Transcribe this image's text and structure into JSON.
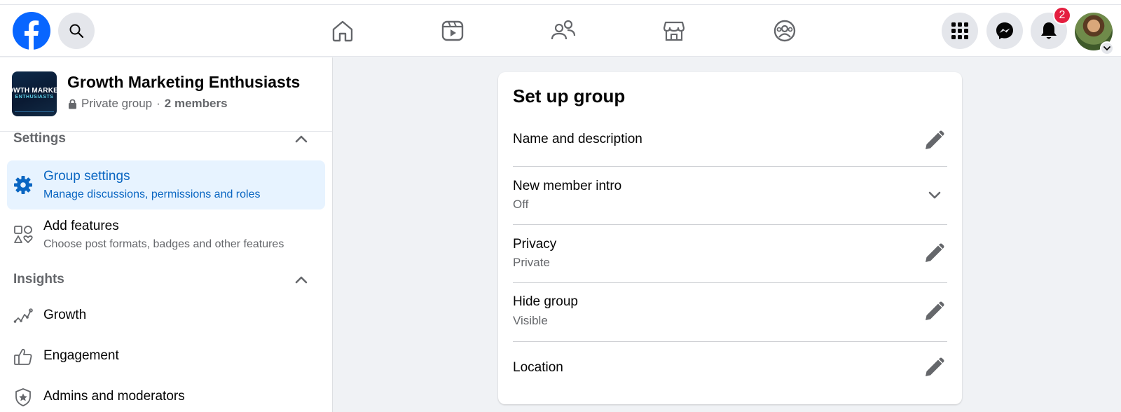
{
  "topbar": {
    "notifications_badge": "2",
    "icons": [
      "facebook-logo",
      "search-icon",
      "home-icon",
      "watch-icon",
      "friends-icon",
      "marketplace-icon",
      "groups-icon",
      "menu-grid-icon",
      "messenger-icon",
      "bell-icon",
      "avatar",
      "chevron-down-icon"
    ]
  },
  "group": {
    "thumb_line1": "OWTH MARKETI",
    "thumb_line2": "ENTHUSIASTS",
    "name": "Growth Marketing Enthusiasts",
    "privacy": "Private group",
    "separator": "·",
    "members": "2 members"
  },
  "sidebar": {
    "settings_title": "Settings",
    "settings_items": [
      {
        "title": "Group settings",
        "subtitle": "Manage discussions, permissions and roles",
        "icon": "gear-icon",
        "active": true
      },
      {
        "title": "Add features",
        "subtitle": "Choose post formats, badges and other features",
        "icon": "shapes-icon",
        "active": false
      }
    ],
    "insights_title": "Insights",
    "insights_items": [
      {
        "title": "Growth",
        "icon": "growth-chart-icon"
      },
      {
        "title": "Engagement",
        "icon": "thumbs-up-icon"
      },
      {
        "title": "Admins and moderators",
        "icon": "shield-star-icon"
      }
    ]
  },
  "setup": {
    "title": "Set up group",
    "rows": [
      {
        "title": "Name and description",
        "subtitle": "",
        "action": "edit-icon"
      },
      {
        "title": "New member intro",
        "subtitle": "Off",
        "action": "chevron-down-icon"
      },
      {
        "title": "Privacy",
        "subtitle": "Private",
        "action": "edit-icon"
      },
      {
        "title": "Hide group",
        "subtitle": "Visible",
        "action": "edit-icon"
      },
      {
        "title": "Location",
        "subtitle": "",
        "action": "edit-icon"
      }
    ]
  },
  "colors": {
    "brand": "#0866ff",
    "active_bg": "#e7f3ff",
    "active_text": "#0a66c2",
    "badge": "#e41e3f",
    "icon_gray": "#65676b"
  }
}
